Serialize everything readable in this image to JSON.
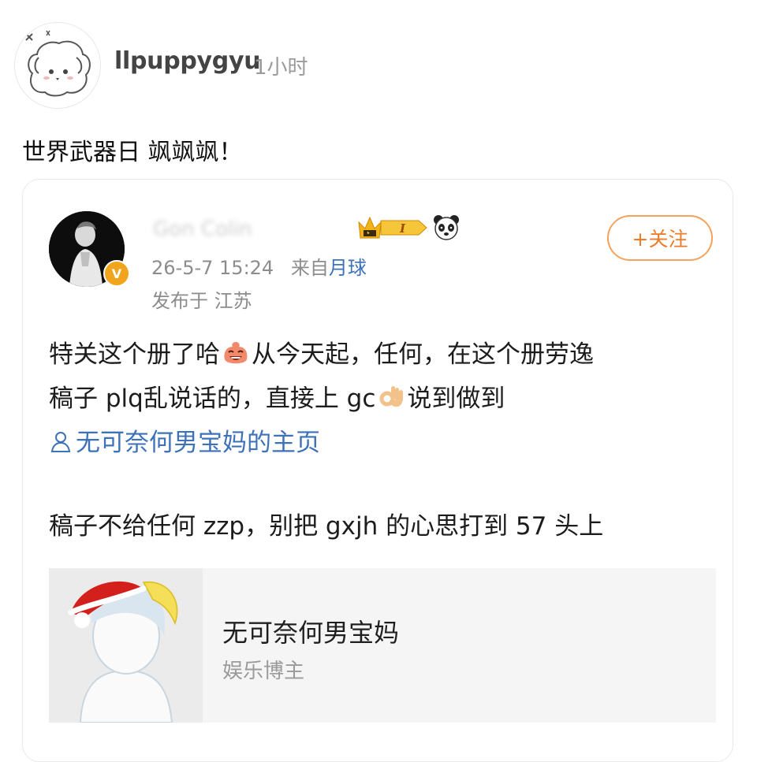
{
  "post": {
    "username": "llpuppygyu",
    "time": "1小时",
    "text": "世界武器日 飒飒飒！"
  },
  "repost": {
    "author_name_blurred": "Gon Colin",
    "follow_label": "+关注",
    "date": "26-5-7 15:24",
    "via_prefix": "来自",
    "via_source": "月球",
    "location": "发布于 江苏",
    "body": {
      "line1_a": "特关这个册了哈",
      "line1_b": "从今天起，任何，在这个册劳逸",
      "line2_a": "稿子 plq乱说话的，直接上 gc",
      "line2_b": "说到做到",
      "mention": "无可奈何男宝妈的主页",
      "para2": "稿子不给任何 zzp，别把 gxjh 的心思打到 57 头上"
    },
    "card": {
      "name": "无可奈何男宝妈",
      "role": "娱乐博主"
    }
  },
  "colors": {
    "accent_orange": "#ee7d2b",
    "link_blue": "#3d72b8",
    "verified_gold": "#f0a51c"
  },
  "icons": [
    "avatar-puppy-drawing",
    "verified-v-icon",
    "crown-level-badge",
    "panda-icon",
    "laughing-emoji",
    "ok-hand-emoji",
    "user-icon"
  ]
}
